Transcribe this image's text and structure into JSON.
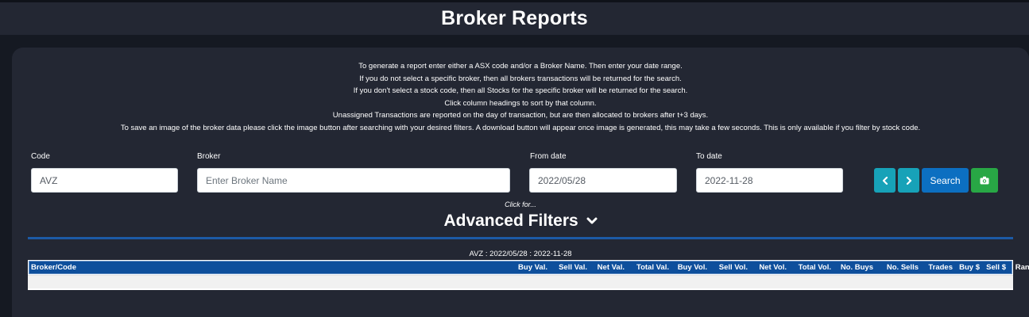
{
  "header": {
    "title": "Broker Reports"
  },
  "instructions": [
    "To generate a report enter either a ASX code and/or a Broker Name. Then enter your date range.",
    "If you do not select a specific broker, then all brokers transactions will be returned for the search.",
    "If you don't select a stock code, then all Stocks for the specific broker will be returned for the search.",
    "Click column headings to sort by that column.",
    "Unassigned Transactions are reported on the day of transaction, but are then allocated to brokers after t+3 days.",
    "To save an image of the broker data please click the image button after searching with your desired filters. A download button will appear once image is generated, this may take a few seconds. This is only available if you filter by stock code."
  ],
  "form": {
    "code": {
      "label": "Code",
      "value": "AVZ"
    },
    "broker": {
      "label": "Broker",
      "placeholder": "Enter Broker Name"
    },
    "from_date": {
      "label": "From date",
      "value": "2022/05/28"
    },
    "to_date": {
      "label": "To date",
      "value": "2022-11-28"
    },
    "search_label": "Search",
    "icons": {
      "prev": "chevron-left-icon",
      "next": "chevron-right-icon",
      "image": "camera-icon"
    }
  },
  "advanced": {
    "click_for": "Click for...",
    "title": "Advanced Filters",
    "icon": "chevron-down-icon"
  },
  "table": {
    "caption": "AVZ : 2022/05/28 : 2022-11-28",
    "first_column": "Broker/Code",
    "columns": [
      "Buy Val.",
      "Sell Val.",
      "Net Val.",
      "Total Val.",
      "Buy Vol.",
      "Sell Vol.",
      "Net Vol.",
      "Total Vol.",
      "No. Buys",
      "No. Sells",
      "Trades",
      "Buy $",
      "Sell $",
      "Rank"
    ]
  },
  "colors": {
    "background": "#151922",
    "panel": "#232733",
    "teal_button": "#17a2b8",
    "search_button": "#0c6fc1",
    "camera_button": "#28a745",
    "table_header": "#0e4f9c",
    "divider": "#1c5aa6"
  }
}
